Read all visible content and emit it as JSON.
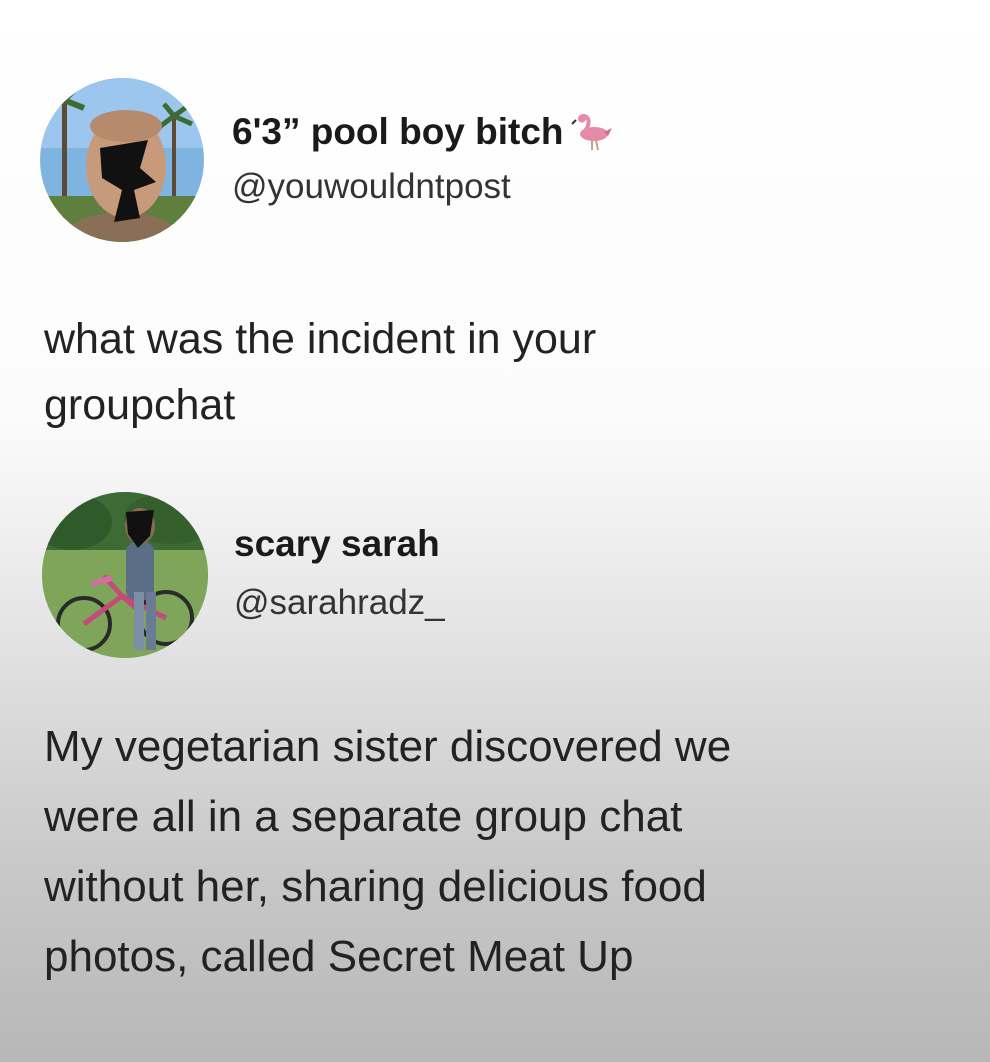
{
  "tweets": [
    {
      "display_name": "6'3” pool boy bitch",
      "name_emoji": "flamingo-icon",
      "handle": "@youwouldntpost",
      "text": "what was the incident in your\ngroupchat"
    },
    {
      "display_name": "scary sarah",
      "handle": "@sarahradz_",
      "text": "My vegetarian sister discovered we\nwere all in a separate group chat\nwithout her, sharing delicious food\nphotos, called Secret Meat Up"
    }
  ],
  "colors": {
    "text": "#222222",
    "handle": "#333333",
    "flamingo": "#e58aa8"
  }
}
